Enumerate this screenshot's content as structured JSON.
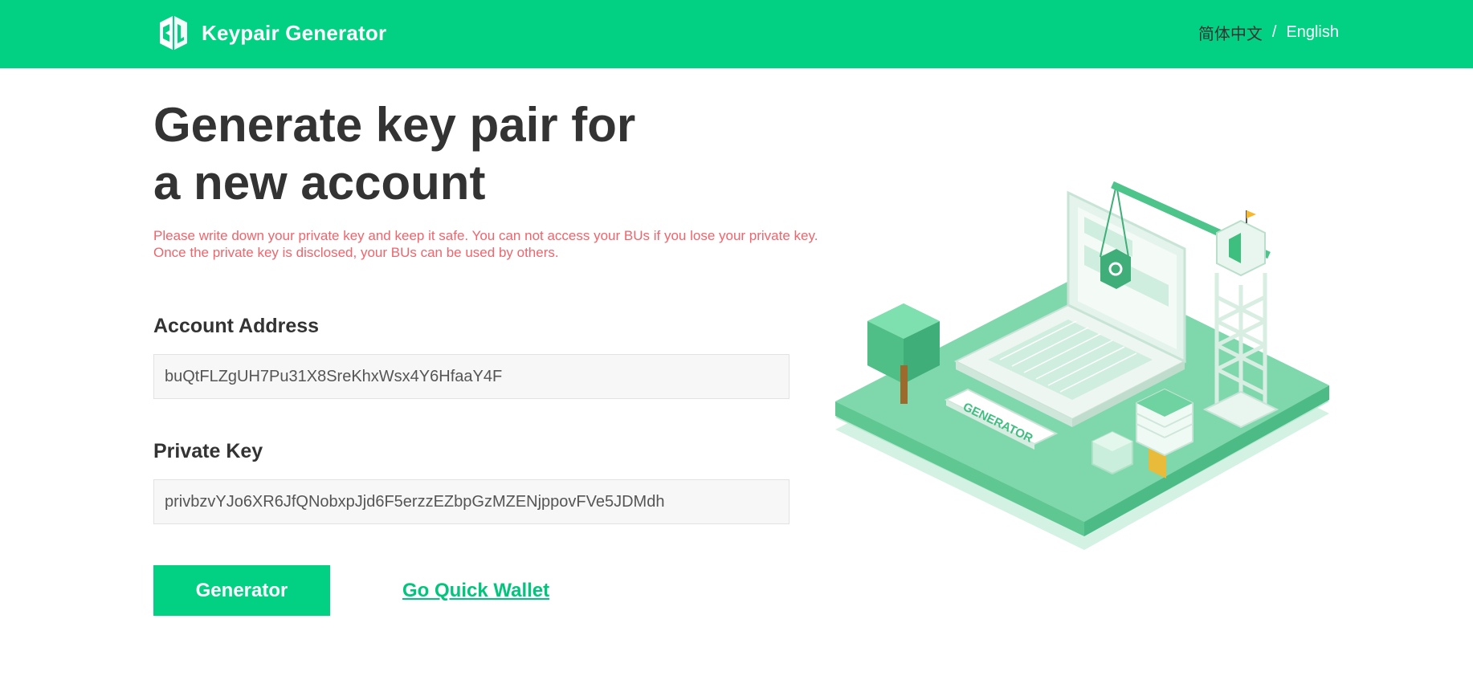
{
  "header": {
    "brand_title": "Keypair Generator",
    "logo_icon": "keypair-logo-icon",
    "lang_cn": "简体中文",
    "lang_separator": "/",
    "lang_en": "English",
    "bar_color": "#02d183"
  },
  "main": {
    "title_line1": "Generate key pair for",
    "title_line2": "a new account",
    "warning_line1": "Please write down your private key and keep it safe. You can not access your BUs if you lose your private key.",
    "warning_line2": "Once the private key is disclosed, your BUs can be used by others.",
    "warning_color": "#f0646c",
    "address_label": "Account Address",
    "address_value": "buQtFLZgUH7Pu31X8SreKhxWsx4Y6HfaaY4F",
    "private_key_label": "Private Key",
    "private_key_value": "privbzvYJo6XR6JfQNobxpJjd6F5erzzEZbpGzMZENjppovFVe5JDMdh",
    "generate_button": "Generator",
    "wallet_link": "Go Quick Wallet",
    "accent_color": "#02d183"
  },
  "illustration": {
    "icon": "generator-isometric-illustration",
    "plaque_text": "GENERATOR"
  }
}
